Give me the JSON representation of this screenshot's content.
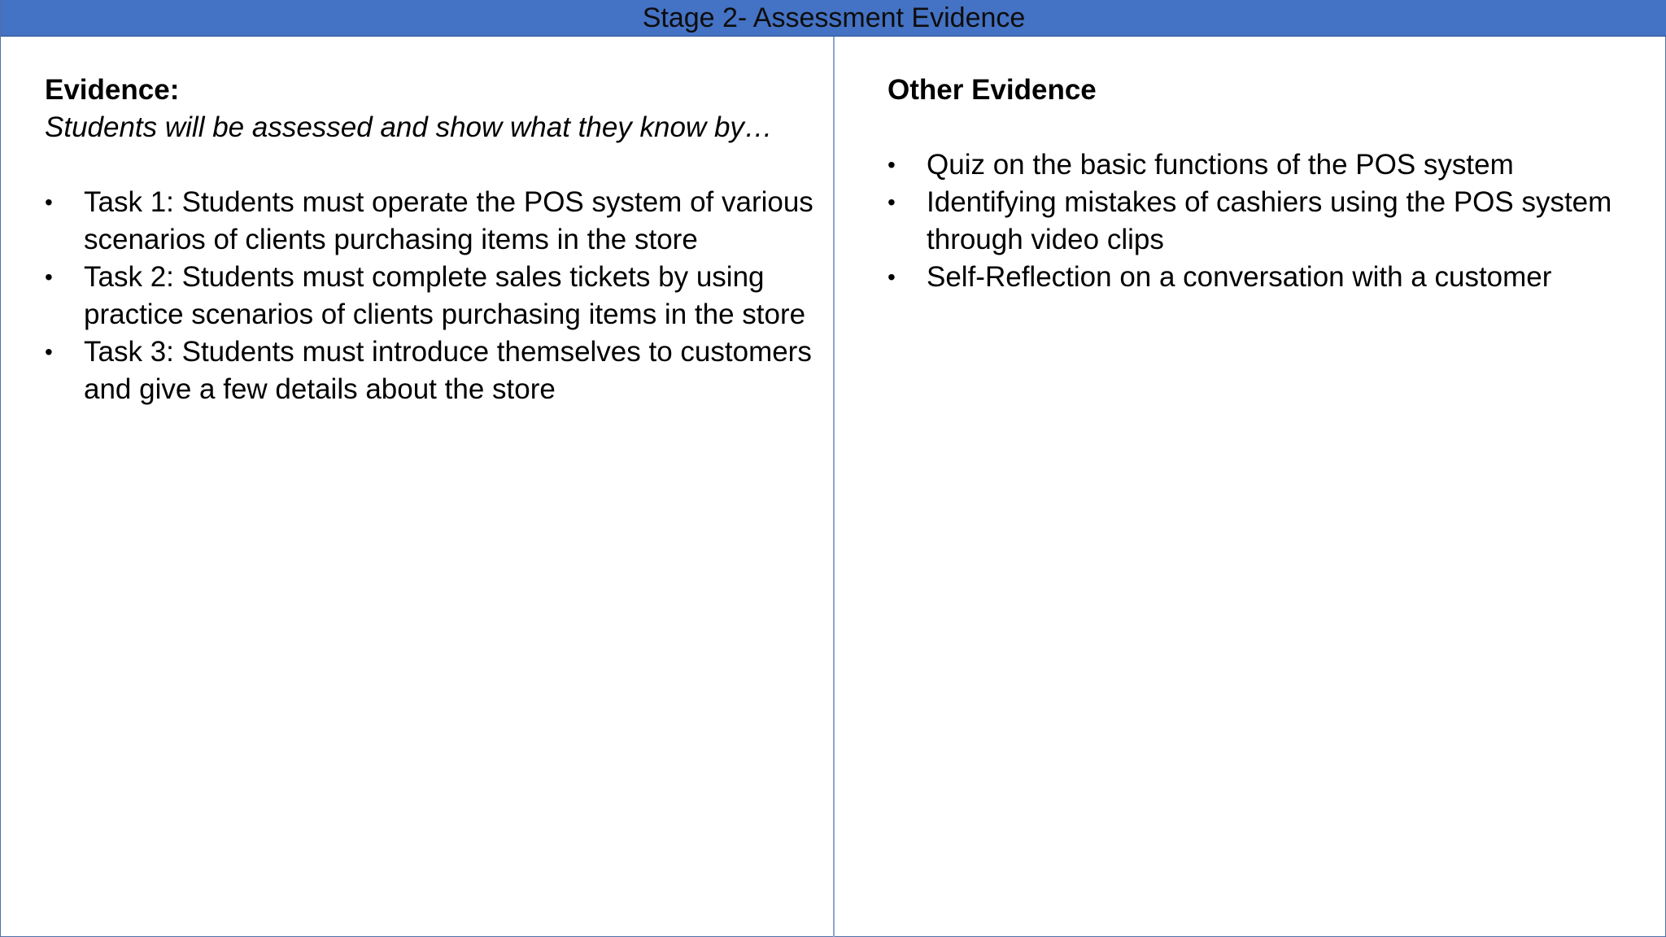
{
  "header": {
    "title": "Stage 2- Assessment Evidence"
  },
  "left": {
    "heading": "Evidence:",
    "subheading": "Students will be assessed and show what they know by…",
    "items": [
      "Task 1: Students must operate the POS system of various scenarios of clients purchasing items in the store",
      "Task 2: Students must complete sales tickets by using practice scenarios of clients purchasing items in the store",
      "Task 3: Students must introduce themselves to customers and give a few details about the store"
    ]
  },
  "right": {
    "heading": "Other Evidence",
    "items": [
      "Quiz on the basic functions of the POS system",
      "Identifying mistakes of cashiers using the POS system through video clips",
      "Self-Reflection on a conversation with a customer"
    ]
  },
  "bullet_glyph": "•",
  "colors": {
    "header_background": "#4472c4",
    "divider": "#8ea7cf"
  }
}
